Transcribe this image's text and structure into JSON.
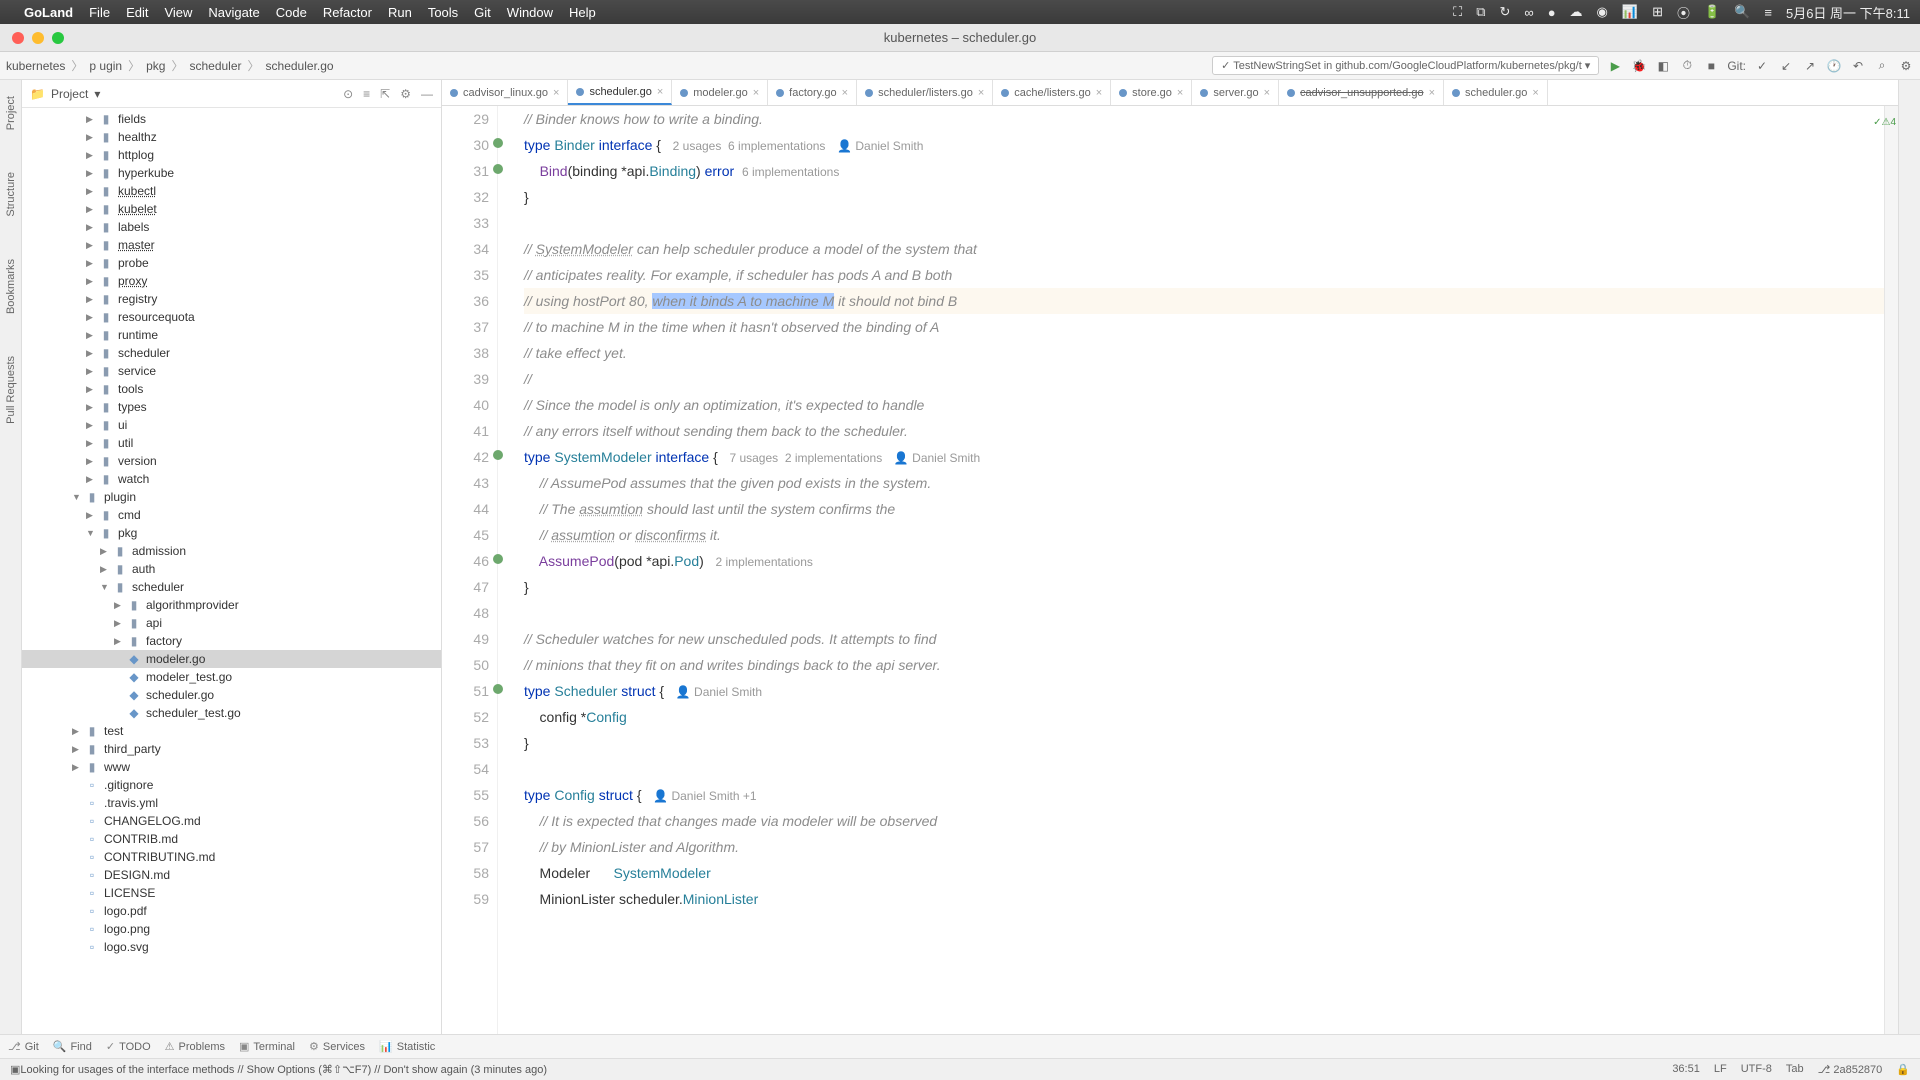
{
  "menubar": {
    "app": "GoLand",
    "items": [
      "File",
      "Edit",
      "View",
      "Navigate",
      "Code",
      "Refactor",
      "Run",
      "Tools",
      "Git",
      "Window",
      "Help"
    ],
    "clock": "5月6日 周一 下午8:11"
  },
  "window": {
    "title": "kubernetes – scheduler.go"
  },
  "breadcrumb": [
    "kubernetes",
    "p ugin",
    "pkg",
    "scheduler",
    "scheduler.go"
  ],
  "runconfig": "TestNewStringSet in github.com/GoogleCloudPlatform/kubernetes/pkg/t",
  "toolbar_git": "Git:",
  "project": {
    "label": "Project",
    "tree": [
      {
        "d": 4,
        "a": "r",
        "t": "folder",
        "n": "fields"
      },
      {
        "d": 4,
        "a": "r",
        "t": "folder",
        "n": "healthz"
      },
      {
        "d": 4,
        "a": "r",
        "t": "folder",
        "n": "httplog"
      },
      {
        "d": 4,
        "a": "r",
        "t": "folder",
        "n": "hyperkube"
      },
      {
        "d": 4,
        "a": "r",
        "t": "folder",
        "n": "kubectl",
        "pkg": true
      },
      {
        "d": 4,
        "a": "r",
        "t": "folder",
        "n": "kubelet",
        "pkg": true
      },
      {
        "d": 4,
        "a": "r",
        "t": "folder",
        "n": "labels"
      },
      {
        "d": 4,
        "a": "r",
        "t": "folder",
        "n": "master",
        "pkg": true
      },
      {
        "d": 4,
        "a": "r",
        "t": "folder",
        "n": "probe"
      },
      {
        "d": 4,
        "a": "r",
        "t": "folder",
        "n": "proxy",
        "pkg": true
      },
      {
        "d": 4,
        "a": "r",
        "t": "folder",
        "n": "registry"
      },
      {
        "d": 4,
        "a": "r",
        "t": "folder",
        "n": "resourcequota"
      },
      {
        "d": 4,
        "a": "r",
        "t": "folder",
        "n": "runtime"
      },
      {
        "d": 4,
        "a": "r",
        "t": "folder",
        "n": "scheduler"
      },
      {
        "d": 4,
        "a": "r",
        "t": "folder",
        "n": "service"
      },
      {
        "d": 4,
        "a": "r",
        "t": "folder",
        "n": "tools"
      },
      {
        "d": 4,
        "a": "r",
        "t": "folder",
        "n": "types"
      },
      {
        "d": 4,
        "a": "r",
        "t": "folder",
        "n": "ui"
      },
      {
        "d": 4,
        "a": "r",
        "t": "folder",
        "n": "util"
      },
      {
        "d": 4,
        "a": "r",
        "t": "folder",
        "n": "version"
      },
      {
        "d": 4,
        "a": "r",
        "t": "folder",
        "n": "watch"
      },
      {
        "d": 3,
        "a": "d",
        "t": "folder",
        "n": "plugin"
      },
      {
        "d": 4,
        "a": "r",
        "t": "folder",
        "n": "cmd"
      },
      {
        "d": 4,
        "a": "d",
        "t": "folder",
        "n": "pkg"
      },
      {
        "d": 5,
        "a": "r",
        "t": "folder",
        "n": "admission"
      },
      {
        "d": 5,
        "a": "r",
        "t": "folder",
        "n": "auth"
      },
      {
        "d": 5,
        "a": "d",
        "t": "folder",
        "n": "scheduler"
      },
      {
        "d": 6,
        "a": "r",
        "t": "folder",
        "n": "algorithmprovider"
      },
      {
        "d": 6,
        "a": "r",
        "t": "folder",
        "n": "api"
      },
      {
        "d": 6,
        "a": "r",
        "t": "folder",
        "n": "factory"
      },
      {
        "d": 6,
        "a": "",
        "t": "gofile",
        "n": "modeler.go",
        "sel": true
      },
      {
        "d": 6,
        "a": "",
        "t": "gofile",
        "n": "modeler_test.go"
      },
      {
        "d": 6,
        "a": "",
        "t": "gofile",
        "n": "scheduler.go"
      },
      {
        "d": 6,
        "a": "",
        "t": "gofile",
        "n": "scheduler_test.go"
      },
      {
        "d": 3,
        "a": "r",
        "t": "folder",
        "n": "test"
      },
      {
        "d": 3,
        "a": "r",
        "t": "folder",
        "n": "third_party"
      },
      {
        "d": 3,
        "a": "r",
        "t": "folder",
        "n": "www"
      },
      {
        "d": 3,
        "a": "",
        "t": "file",
        "n": ".gitignore"
      },
      {
        "d": 3,
        "a": "",
        "t": "file",
        "n": ".travis.yml"
      },
      {
        "d": 3,
        "a": "",
        "t": "file",
        "n": "CHANGELOG.md"
      },
      {
        "d": 3,
        "a": "",
        "t": "file",
        "n": "CONTRIB.md"
      },
      {
        "d": 3,
        "a": "",
        "t": "file",
        "n": "CONTRIBUTING.md"
      },
      {
        "d": 3,
        "a": "",
        "t": "file",
        "n": "DESIGN.md"
      },
      {
        "d": 3,
        "a": "",
        "t": "file",
        "n": "LICENSE"
      },
      {
        "d": 3,
        "a": "",
        "t": "file",
        "n": "logo.pdf"
      },
      {
        "d": 3,
        "a": "",
        "t": "file",
        "n": "logo.png"
      },
      {
        "d": 3,
        "a": "",
        "t": "file",
        "n": "logo.svg"
      }
    ]
  },
  "tabs": [
    {
      "n": "cadvisor_linux.go"
    },
    {
      "n": "scheduler.go",
      "active": true
    },
    {
      "n": "modeler.go"
    },
    {
      "n": "factory.go"
    },
    {
      "n": "scheduler/listers.go"
    },
    {
      "n": "cache/listers.go"
    },
    {
      "n": "store.go"
    },
    {
      "n": "server.go"
    },
    {
      "n": "cadvisor_unsupported.go",
      "strike": true
    },
    {
      "n": "scheduler.go"
    }
  ],
  "inspection": {
    "warn": "4"
  },
  "code": {
    "start": 29,
    "lines": [
      {
        "impl": false,
        "html": "<span class='c-cm'>// Binder knows how to write a binding.</span>"
      },
      {
        "impl": true,
        "html": "<span class='c-kw'>type</span> <span class='c-type'>Binder</span> <span class='c-kw'>interface</span> {   <span class='c-hint'>2 usages  6 implementations</span>   <span class='c-auth'>👤 Daniel Smith</span>"
      },
      {
        "impl": true,
        "html": "    <span class='c-fn'>Bind</span>(binding *<span class='c-id'>api</span>.<span class='c-type'>Binding</span>) <span class='c-kw'>error</span>  <span class='c-hint'>6 implementations</span>"
      },
      {
        "impl": false,
        "html": "}"
      },
      {
        "impl": false,
        "html": ""
      },
      {
        "impl": false,
        "diffr": true,
        "html": "<span class='c-cm'>// <span class='c-ul'>SystemModeler</span> can help scheduler produce a model of the system that</span>"
      },
      {
        "impl": false,
        "html": "<span class='c-cm'>// anticipates reality. For example, if scheduler has pods A and B both</span>"
      },
      {
        "impl": false,
        "cur": true,
        "html": "<span class='c-cm'>// using hostPort 80, <span class='c-sel'>when it binds A to machine M</span> it should not bind B</span>"
      },
      {
        "impl": false,
        "html": "<span class='c-cm'>// to machine M in the time when it hasn't observed the binding of A</span>"
      },
      {
        "impl": false,
        "html": "<span class='c-cm'>// take effect yet.</span>"
      },
      {
        "impl": false,
        "diffr": true,
        "html": "<span class='c-cm'>//</span>"
      },
      {
        "impl": false,
        "html": "<span class='c-cm'>// Since the model is only an optimization, it's expected to handle</span>"
      },
      {
        "impl": false,
        "html": "<span class='c-cm'>// any errors itself without sending them back to the scheduler.</span>"
      },
      {
        "impl": true,
        "html": "<span class='c-kw'>type</span> <span class='c-type'>SystemModeler</span> <span class='c-kw'>interface</span> {   <span class='c-hint'>7 usages  2 implementations</span>   <span class='c-auth'>👤 Daniel Smith</span>"
      },
      {
        "impl": false,
        "html": "    <span class='c-cm'>// AssumePod assumes that the given pod exists in the system.</span>"
      },
      {
        "impl": false,
        "html": "    <span class='c-cm'>// The <span class='c-ul'>assumtion</span> should last until the system confirms the</span>"
      },
      {
        "impl": false,
        "html": "    <span class='c-cm'>// <span class='c-ul'>assumtion</span> or <span class='c-ul'>disconfirms</span> it.</span>"
      },
      {
        "impl": true,
        "html": "    <span class='c-fn'>AssumePod</span>(pod *<span class='c-id'>api</span>.<span class='c-type'>Pod</span>)   <span class='c-hint'>2 implementations</span>"
      },
      {
        "impl": false,
        "html": "}"
      },
      {
        "impl": false,
        "html": ""
      },
      {
        "impl": false,
        "html": "<span class='c-cm'>// Scheduler watches for new unscheduled pods. It attempts to find</span>"
      },
      {
        "impl": false,
        "html": "<span class='c-cm'>// minions that they fit on and writes bindings back to the api server.</span>"
      },
      {
        "impl": true,
        "html": "<span class='c-kw'>type</span> <span class='c-type'>Scheduler</span> <span class='c-kw'>struct</span> {   <span class='c-auth'>👤 Daniel Smith</span>"
      },
      {
        "impl": false,
        "html": "    config *<span class='c-type'>Config</span>"
      },
      {
        "impl": false,
        "html": "}"
      },
      {
        "impl": false,
        "html": ""
      },
      {
        "impl": false,
        "html": "<span class='c-kw'>type</span> <span class='c-type'>Config</span> <span class='c-kw'>struct</span> {   <span class='c-auth'>👤 Daniel Smith +1</span>"
      },
      {
        "impl": false,
        "html": "    <span class='c-cm'>// It is expected that changes made via modeler will be observed</span>"
      },
      {
        "impl": false,
        "html": "    <span class='c-cm'>// by MinionLister and Algorithm.</span>"
      },
      {
        "impl": false,
        "html": "    Modeler      <span class='c-type'>SystemModeler</span>"
      },
      {
        "impl": false,
        "html": "    MinionLister <span class='c-id'>scheduler</span>.<span class='c-type'>MinionLister</span>"
      }
    ]
  },
  "bottomTabs": [
    "Git",
    "Find",
    "TODO",
    "Problems",
    "Terminal",
    "Services",
    "Statistic"
  ],
  "status": {
    "msg": "Looking for usages of the interface methods // Show Options (⌘⇧⌥F7) // Don't show again (3 minutes ago)",
    "pos": "36:51",
    "enc": "LF",
    "charset": "UTF-8",
    "indent": "Tab",
    "branch": "2a852870"
  }
}
